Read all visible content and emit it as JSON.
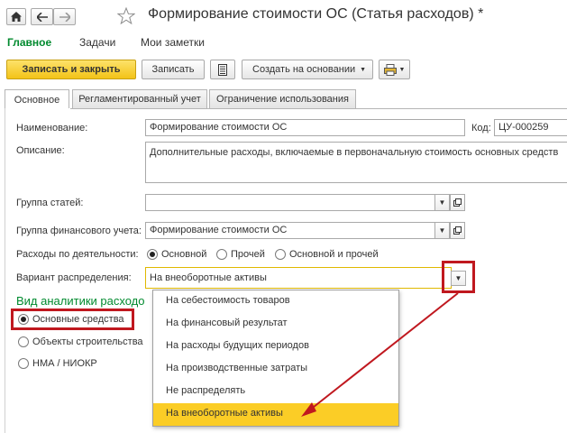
{
  "window": {
    "title": "Формирование стоимости ОС (Статья расходов) *",
    "home_icon": "home-icon",
    "back_icon": "arrow-left-icon",
    "forward_icon": "arrow-right-icon",
    "favorite_icon": "star-icon"
  },
  "menu": {
    "items": [
      "Главное",
      "Задачи",
      "Мои заметки"
    ],
    "active_color": "#008a2e"
  },
  "toolbar": {
    "save_close_label": "Записать и закрыть",
    "save_label": "Записать",
    "create_based_label": "Создать на основании",
    "accent": "#f3c318"
  },
  "tabs": [
    "Основное",
    "Регламентированный учет",
    "Ограничение использования"
  ],
  "form": {
    "name_label": "Наименование:",
    "name_value": "Формирование стоимости ОС",
    "code_label": "Код:",
    "code_value": "ЦУ-000259",
    "description_label": "Описание:",
    "description_value": "Дополнительные расходы, включаемые в первоначальную стоимость основных средств",
    "group_label": "Группа статей:",
    "group_value": "",
    "fin_group_label": "Группа финансового учета:",
    "fin_group_value": "Формирование стоимости ОС",
    "activity_label": "Расходы по деятельности:",
    "activity_options": [
      "Основной",
      "Прочей",
      "Основной и прочей"
    ],
    "activity_selected": "Основной",
    "distribution_label": "Вариант распределения:",
    "distribution_value": "На внеоборотные активы",
    "analytics_heading": "Вид аналитики расходо",
    "analytics_options": [
      "Основные средства",
      "Объекты строительства",
      "НМА / НИОКР"
    ],
    "analytics_selected": "Основные средства"
  },
  "dropdown": {
    "items": [
      "На себестоимость товаров",
      "На финансовый результат",
      "На расходы будущих периодов",
      "На производственные затраты",
      "Не распределять",
      "На внеоборотные активы"
    ],
    "selected": "На внеоборотные активы",
    "highlight_color": "#fbcd26"
  },
  "annotation": {
    "color": "#c0181f"
  }
}
